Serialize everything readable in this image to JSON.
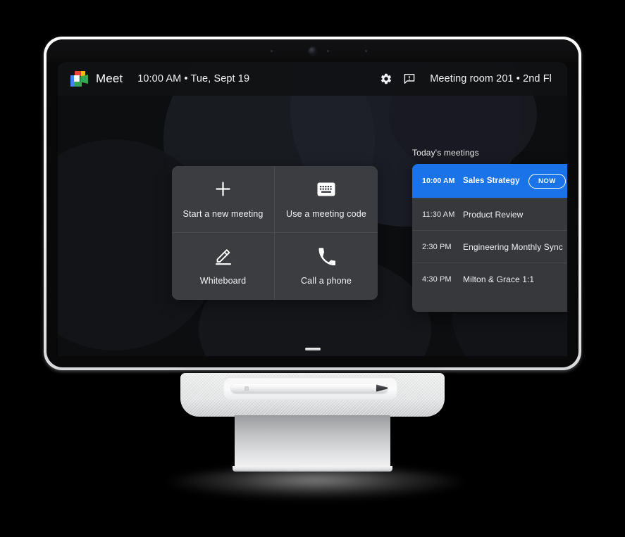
{
  "device": {
    "type": "google-meet-series-one-desk-64",
    "camera_icon": "camera-lens"
  },
  "topbar": {
    "logo": "google-meet-logo",
    "app_name": "Meet",
    "clock": "10:00 AM • Tue, Sept 19",
    "settings_icon": "gear-icon",
    "feedback_icon": "feedback-icon",
    "room": "Meeting room 201 • 2nd Fl"
  },
  "tiles": [
    {
      "icon": "plus-icon",
      "label": "Start a new meeting"
    },
    {
      "icon": "keyboard-icon",
      "label": "Use a meeting code"
    },
    {
      "icon": "whiteboard-pencil-icon",
      "label": "Whiteboard"
    },
    {
      "icon": "phone-icon",
      "label": "Call a phone"
    }
  ],
  "meetings_panel": {
    "title": "Today's meetings",
    "now_label": "NOW",
    "items": [
      {
        "time": "10:00 AM",
        "title": "Sales Strategy",
        "current": true
      },
      {
        "time": "11:30 AM",
        "title": "Product Review",
        "current": false
      },
      {
        "time": "2:30 PM",
        "title": "Engineering Monthly Sync",
        "current": false
      },
      {
        "time": "4:30 PM",
        "title": "Milton & Grace 1:1",
        "current": false
      }
    ]
  },
  "colors": {
    "accent_blue": "#1a73e8",
    "tile_bg": "#3c3d41",
    "row_bg": "#37383c",
    "screen_bg": "#0d0e10"
  }
}
